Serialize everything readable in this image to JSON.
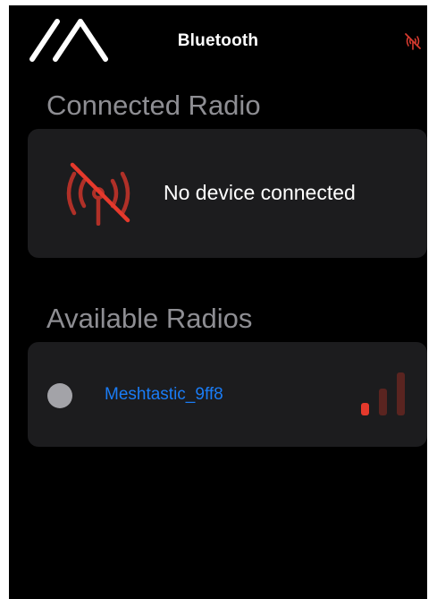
{
  "nav": {
    "title": "Bluetooth",
    "logo_icon": "meshtastic-logo-icon",
    "status_icon": "antenna-off-icon"
  },
  "connected_section": {
    "header": "Connected Radio",
    "status_icon": "antenna-off-icon",
    "status_text": "No device connected"
  },
  "available_section": {
    "header": "Available Radios",
    "devices": [
      {
        "name": "Meshtastic_9ff8",
        "indicator_icon": "circle-icon",
        "signal_icon": "signal-strength-icon",
        "signal_bars_active": 1,
        "signal_bars_total": 3
      }
    ]
  },
  "colors": {
    "background": "#000000",
    "card": "#1c1c1e",
    "header_gray": "#8e8e93",
    "link_blue": "#1a7cf5",
    "alert_red": "#d63a2f",
    "alert_red_dim": "#5a2420",
    "indicator_gray": "#a3a3a8"
  }
}
